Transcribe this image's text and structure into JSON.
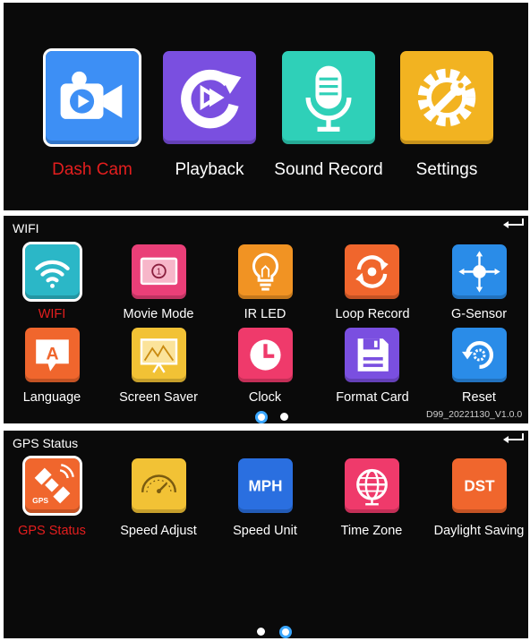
{
  "top_menu": {
    "items": [
      {
        "label": "Dash Cam",
        "icon": "video-camera-icon",
        "color": "#3d8ff5",
        "active": true
      },
      {
        "label": "Playback",
        "icon": "playback-icon",
        "color": "#7a4fe0",
        "active": false
      },
      {
        "label": "Sound Record",
        "icon": "microphone-icon",
        "color": "#2fd0b8",
        "active": false
      },
      {
        "label": "Settings",
        "icon": "gear-wrench-icon",
        "color": "#f2b321",
        "active": false
      }
    ]
  },
  "settings_page1": {
    "title": "WIFI",
    "version": "D99_20221130_V1.0.0",
    "items": [
      {
        "label": "WIFI",
        "icon": "wifi-icon",
        "color": "#2bb7c7",
        "active": true
      },
      {
        "label": "Movie Mode",
        "icon": "movie-mode-icon",
        "color": "#ea3f78",
        "active": false
      },
      {
        "label": "IR LED",
        "icon": "bulb-icon",
        "color": "#f19323",
        "active": false
      },
      {
        "label": "Loop Record",
        "icon": "loop-icon",
        "color": "#f0662d",
        "active": false
      },
      {
        "label": "G-Sensor",
        "icon": "g-sensor-icon",
        "color": "#2a8ce8",
        "active": false
      },
      {
        "label": "Language",
        "icon": "language-icon",
        "color": "#f0662d",
        "active": false
      },
      {
        "label": "Screen Saver",
        "icon": "screen-saver-icon",
        "color": "#f2c235",
        "active": false
      },
      {
        "label": "Clock",
        "icon": "clock-icon",
        "color": "#ef3a6b",
        "active": false
      },
      {
        "label": "Format Card",
        "icon": "floppy-icon",
        "color": "#7a4fe0",
        "active": false
      },
      {
        "label": "Reset",
        "icon": "reset-icon",
        "color": "#2a8ce8",
        "active": false
      }
    ],
    "page_index": 1,
    "page_count": 2
  },
  "settings_page2": {
    "title": "GPS Status",
    "items": [
      {
        "label": "GPS Status",
        "icon": "satellite-icon",
        "color": "#f0662d",
        "active": true,
        "badge": "GPS"
      },
      {
        "label": "Speed Adjust",
        "icon": "speedometer-icon",
        "color": "#f2c235",
        "active": false
      },
      {
        "label": "Speed Unit",
        "icon": "mph-icon",
        "color": "#2a6fe0",
        "active": false,
        "badge": "MPH"
      },
      {
        "label": "Time Zone",
        "icon": "globe-icon",
        "color": "#ef3a6b",
        "active": false
      },
      {
        "label": "Daylight Saving",
        "icon": "dst-icon",
        "color": "#f0662d",
        "active": false,
        "badge": "DST"
      }
    ],
    "page_index": 2,
    "page_count": 2
  }
}
